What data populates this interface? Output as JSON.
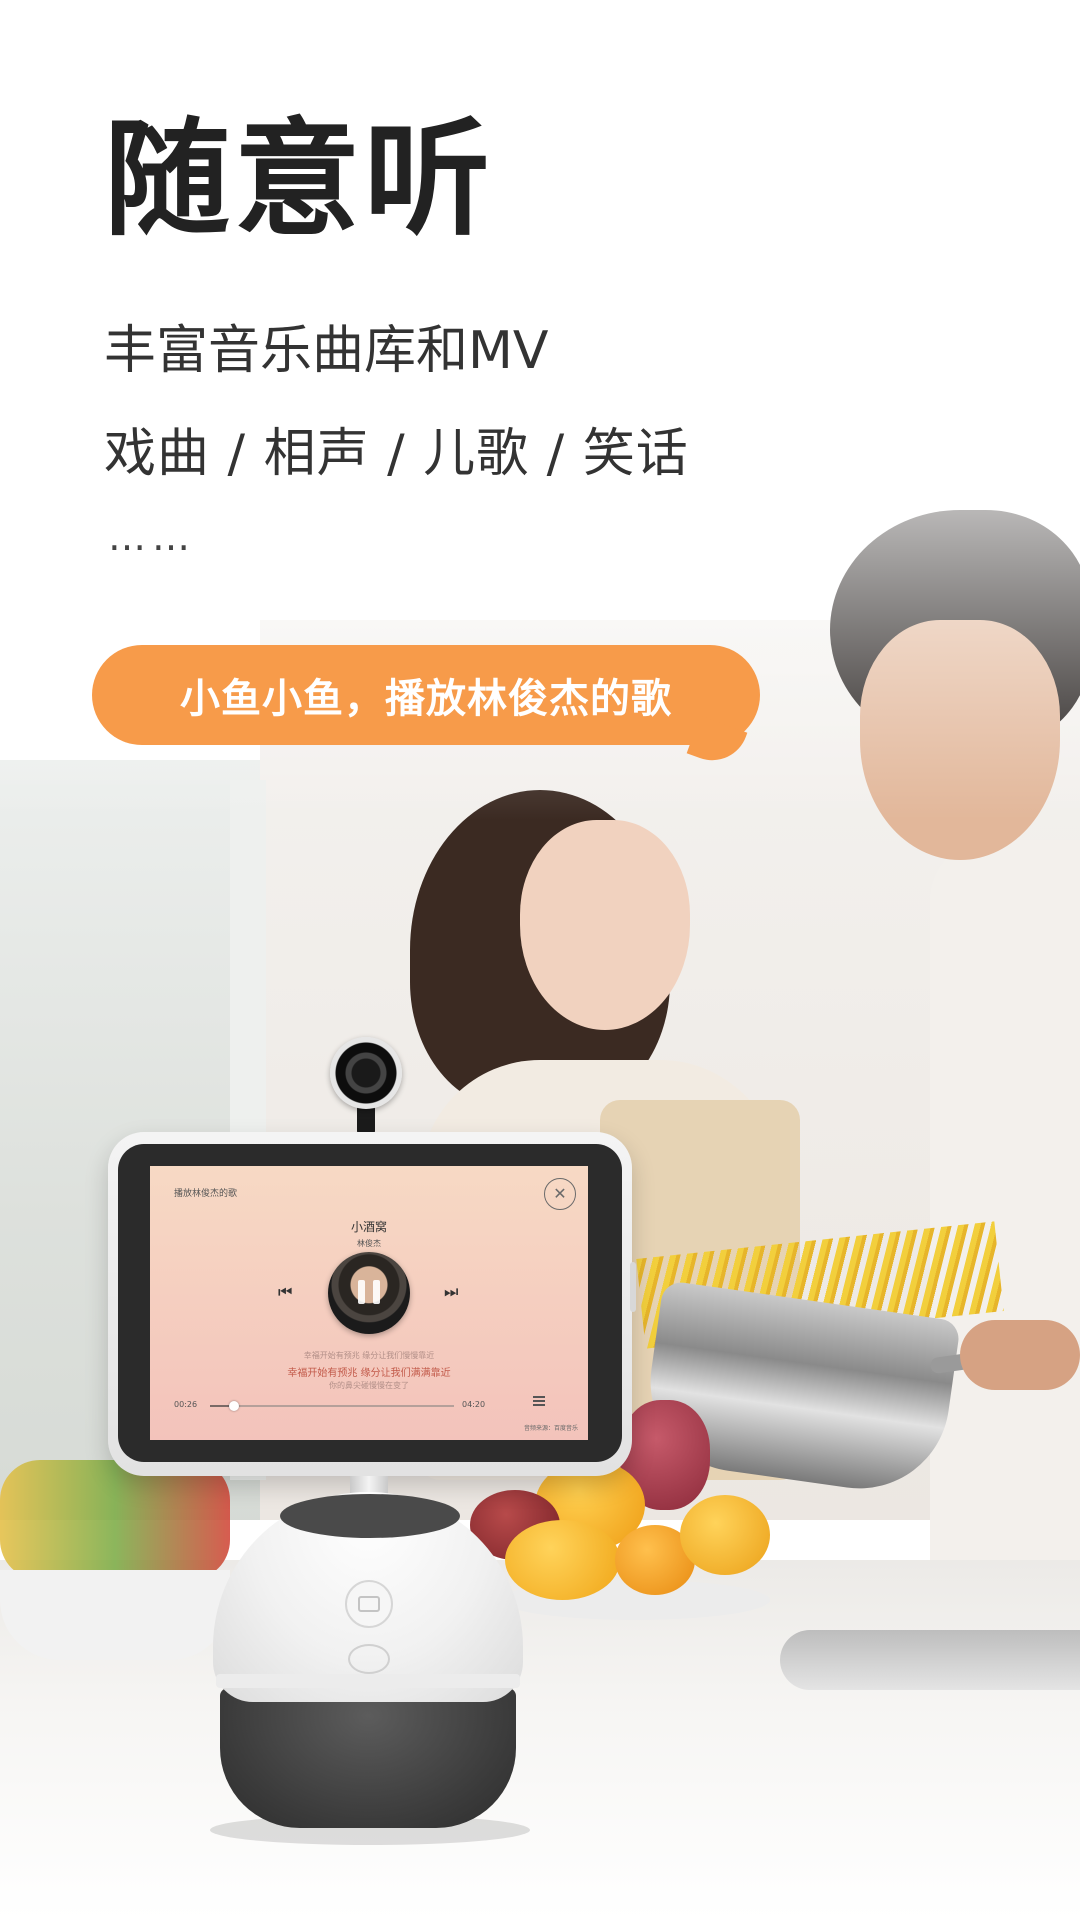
{
  "page": {
    "headline": "随意听",
    "subline_1": "丰富音乐曲库和MV",
    "subline_2": "戏曲 / 相声 / 儿歌 / 笑话",
    "ellipsis": "……"
  },
  "speech_bubble": {
    "text": "小鱼小鱼，播放林俊杰的歌",
    "color": "#f79b4a"
  },
  "device_screen": {
    "heading": "播放林俊杰的歌",
    "close_icon": "close-icon",
    "song_title": "小酒窝",
    "artist": "林俊杰",
    "lyric_previous": "幸福开始有预兆 缘分让我们慢慢靠近",
    "lyric_current": "幸福开始有预兆 缘分让我们满满靠近",
    "lyric_next": "你的鼻尖碰慢慢在变了",
    "time_current": "00:26",
    "time_total": "04:20",
    "progress": 0.1,
    "source": "音频来源：百度音乐",
    "icons": {
      "previous": "previous-track-icon",
      "next": "next-track-icon",
      "pause": "pause-icon",
      "playlist": "playlist-icon"
    }
  },
  "colors": {
    "headline": "#222222",
    "bubble": "#f79b4a",
    "screen_gradient_top": "#f7d9c4",
    "screen_gradient_bottom": "#f3c3bb"
  }
}
